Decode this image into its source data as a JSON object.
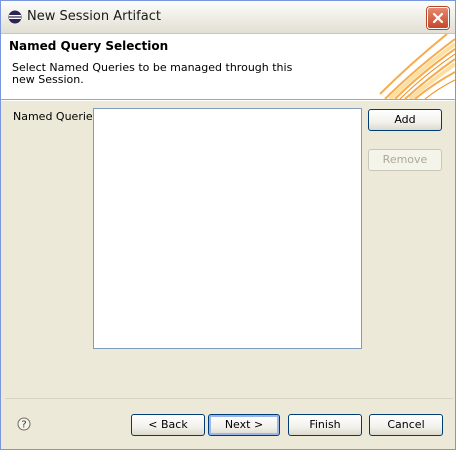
{
  "window": {
    "title": "New Session Artifact"
  },
  "banner": {
    "title": "Named Query Selection",
    "description": "Select Named Queries to be managed through this new Session."
  },
  "form": {
    "named_queries_label": "Named Queries",
    "named_queries_items": []
  },
  "side_buttons": {
    "add": "Add",
    "remove": "Remove"
  },
  "footer": {
    "back": "< Back",
    "next": "Next >",
    "finish": "Finish",
    "cancel": "Cancel"
  },
  "colors": {
    "accent": "#f5a623",
    "title_bar_text": "#1a1a1a",
    "close_button": "#c8452a"
  },
  "icons": [
    "eclipse-app-icon",
    "close-icon",
    "help-icon",
    "wizard-banner-art"
  ]
}
